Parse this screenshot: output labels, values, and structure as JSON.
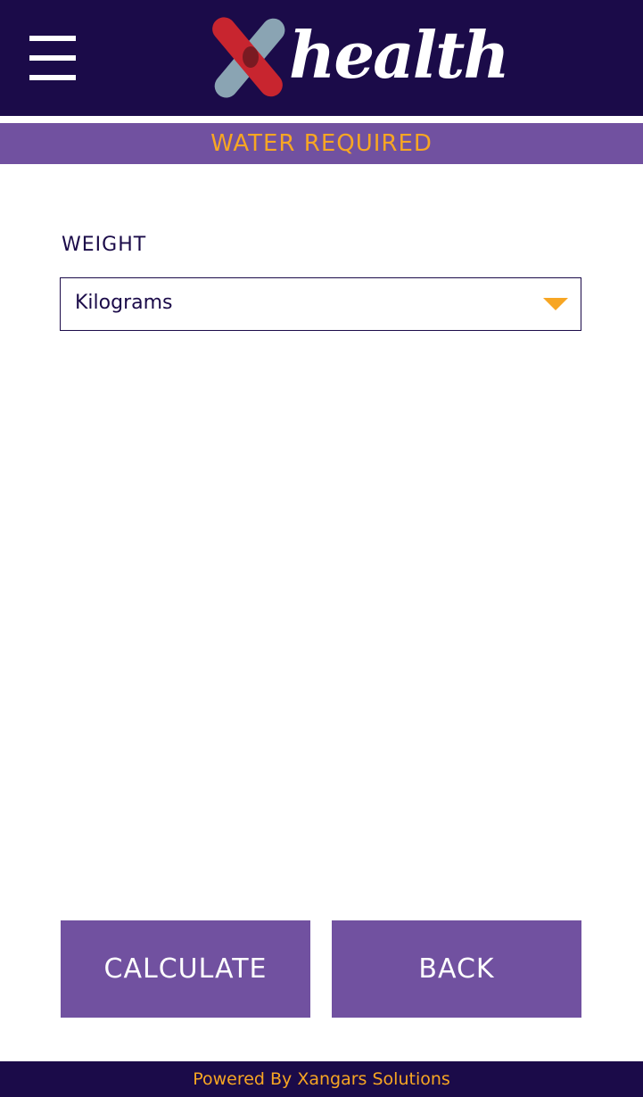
{
  "header": {
    "logo_text": "health",
    "menu_icon": "hamburger-menu-icon"
  },
  "page": {
    "title": "WATER REQUIRED"
  },
  "form": {
    "weight_label": "WEIGHT",
    "weight_unit": "Kilograms"
  },
  "buttons": {
    "calculate": "CALCULATE",
    "back": "BACK"
  },
  "footer": {
    "text": "Powered By Xangars Solutions"
  },
  "colors": {
    "header_bg": "#1b0b49",
    "accent_purple": "#7151a0",
    "accent_orange": "#f7a623",
    "logo_red": "#c8252f",
    "logo_blue": "#8aa4b3"
  }
}
